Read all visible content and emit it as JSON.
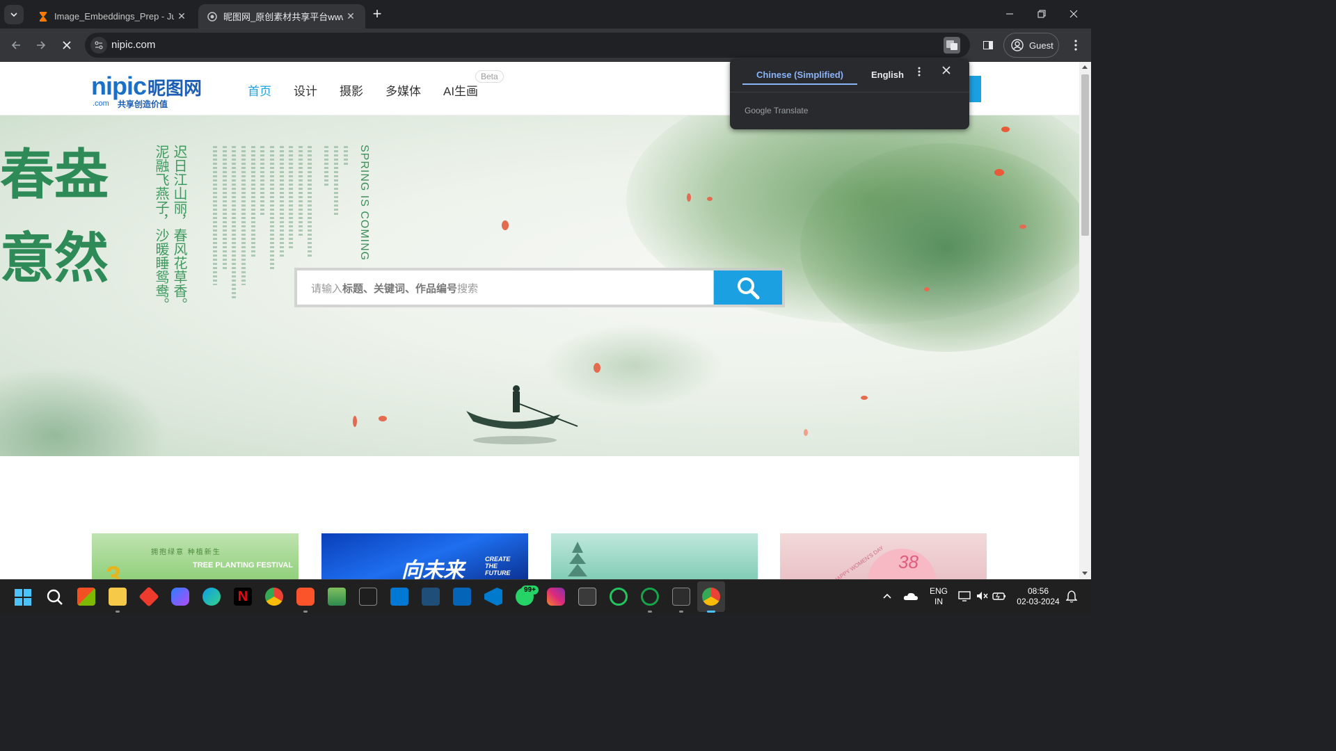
{
  "browser": {
    "tabs": [
      {
        "title": "Image_Embeddings_Prep - Jupy",
        "active": false,
        "icon": "hourglass-icon"
      },
      {
        "title": "昵图网_原创素材共享平台www.",
        "active": true,
        "icon": "globe-icon"
      }
    ],
    "new_tab_label": "+",
    "url": "nipic.com",
    "profile_label": "Guest",
    "window_controls": [
      "minimize",
      "restore",
      "close"
    ]
  },
  "translate_popup": {
    "source_language": "Chinese (Simplified)",
    "target_language": "English",
    "brand": "Google Translate"
  },
  "site": {
    "logo": {
      "brand": "nipic",
      "cn_name": "昵图网",
      "domain": ".com",
      "slogan": "共享创造价值"
    },
    "nav": [
      {
        "label": "首页",
        "active": true
      },
      {
        "label": "设计",
        "active": false
      },
      {
        "label": "摄影",
        "active": false
      },
      {
        "label": "多媒体",
        "active": false
      },
      {
        "label": "AI生画",
        "active": false
      }
    ],
    "nav_badge": "Beta",
    "accent_color": "#1ba1e2",
    "hero": {
      "title_lines": [
        "春盎",
        "意然"
      ],
      "poem_columns": [
        "迟日江山丽，春风花草香。",
        "泥融飞燕子，沙暖睡鸳鸯。"
      ],
      "spring_text": "SPRING IS COMING"
    },
    "search": {
      "placeholder_prefix": "请输入",
      "placeholder_keywords": "标题、关键词、作品编号",
      "placeholder_suffix": "搜索"
    },
    "thumbnails": [
      {
        "label": "TREE PLANTING FESTIVAL",
        "sub": "拥抱绿意 种植新生"
      },
      {
        "label": "向未来",
        "sub": "CREATE THE FUTURE"
      },
      {
        "label": "",
        "sub": ""
      },
      {
        "label": "38",
        "sub": "HAPPY WOMEN'S DAY"
      }
    ]
  },
  "taskbar": {
    "language": {
      "line1": "ENG",
      "line2": "IN"
    },
    "time": "08:56",
    "date": "02-03-2024",
    "badge_count": "99+",
    "apps": [
      "windows-start-icon",
      "search-icon",
      "store-icon",
      "file-explorer-icon",
      "anydesk-icon",
      "copilot-icon",
      "edge-icon",
      "netflix-icon",
      "chrome-icon",
      "brave-icon",
      "notepad-icon",
      "terminal-icon",
      "windows-app-icon",
      "prime-video-icon",
      "outlook-icon",
      "vscode-icon",
      "whatsapp-icon",
      "instagram-icon",
      "settings-app-icon",
      "loader-icon",
      "loader-icon-2",
      "cmd-icon",
      "chrome-active-icon"
    ]
  }
}
